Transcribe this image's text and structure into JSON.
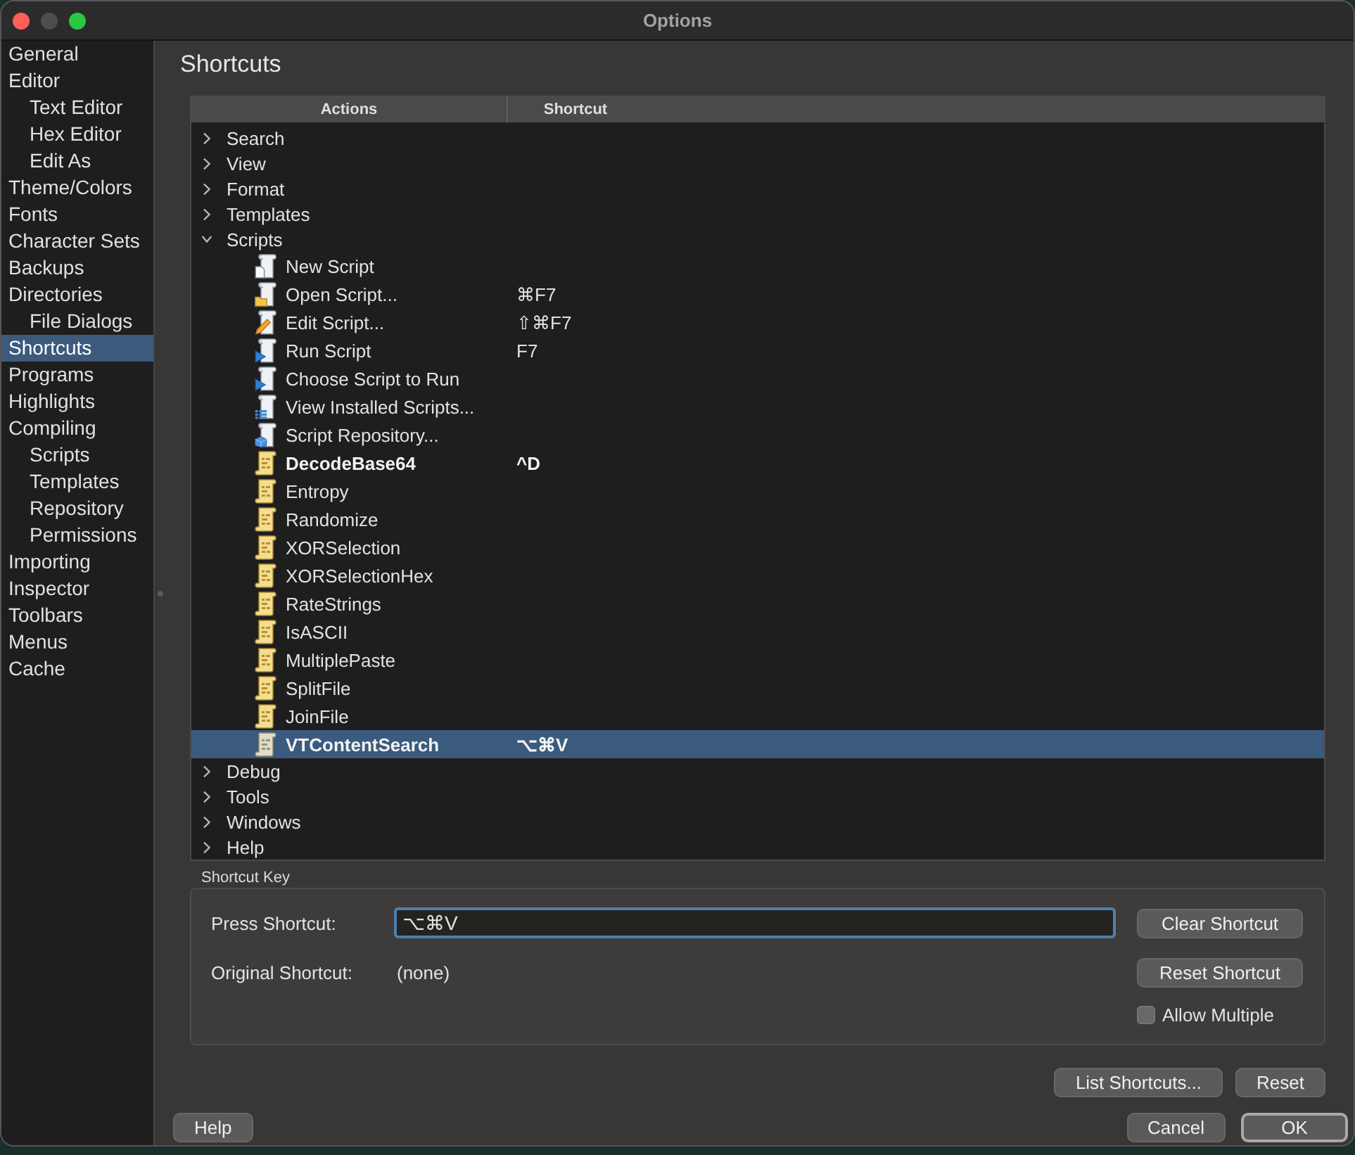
{
  "window": {
    "title": "Options",
    "buttons": [
      {
        "kind": "close",
        "disabled": false
      },
      {
        "kind": "minimize",
        "disabled": true
      },
      {
        "kind": "zoom",
        "disabled": false
      }
    ]
  },
  "sidebar": {
    "items": [
      {
        "label": "General",
        "selected": false
      },
      {
        "label": "Editor",
        "selected": false,
        "children": [
          {
            "label": "Text Editor",
            "selected": false
          },
          {
            "label": "Hex Editor",
            "selected": false
          },
          {
            "label": "Edit As",
            "selected": false
          }
        ]
      },
      {
        "label": "Theme/Colors",
        "selected": false
      },
      {
        "label": "Fonts",
        "selected": false
      },
      {
        "label": "Character Sets",
        "selected": false
      },
      {
        "label": "Backups",
        "selected": false
      },
      {
        "label": "Directories",
        "selected": false,
        "children": [
          {
            "label": "File Dialogs",
            "selected": false
          }
        ]
      },
      {
        "label": "Shortcuts",
        "selected": true
      },
      {
        "label": "Programs",
        "selected": false
      },
      {
        "label": "Highlights",
        "selected": false
      },
      {
        "label": "Compiling",
        "selected": false,
        "children": [
          {
            "label": "Scripts",
            "selected": false
          },
          {
            "label": "Templates",
            "selected": false
          },
          {
            "label": "Repository",
            "selected": false
          },
          {
            "label": "Permissions",
            "selected": false
          }
        ]
      },
      {
        "label": "Importing",
        "selected": false
      },
      {
        "label": "Inspector",
        "selected": false
      },
      {
        "label": "Toolbars",
        "selected": false
      },
      {
        "label": "Menus",
        "selected": false
      },
      {
        "label": "Cache",
        "selected": false
      }
    ]
  },
  "page": {
    "title": "Shortcuts"
  },
  "actions_tree": {
    "columns": [
      "Actions",
      "Shortcut"
    ],
    "rows": [
      {
        "label": "Search",
        "expanded": false,
        "selected": false
      },
      {
        "label": "View",
        "expanded": false,
        "selected": false
      },
      {
        "label": "Format",
        "expanded": false,
        "selected": false
      },
      {
        "label": "Templates",
        "expanded": false,
        "selected": false
      },
      {
        "label": "Scripts",
        "expanded": true,
        "selected": false,
        "children": [
          {
            "label": "New Script",
            "kind": "new",
            "selected": false,
            "modified": false
          },
          {
            "label": "Open Script...",
            "kind": "open",
            "shortcut": "⌘F7",
            "selected": false,
            "modified": false
          },
          {
            "label": "Edit Script...",
            "kind": "edit",
            "shortcut": "⇧⌘F7",
            "selected": false,
            "modified": false
          },
          {
            "label": "Run Script",
            "kind": "run",
            "shortcut": "F7",
            "selected": false,
            "modified": false
          },
          {
            "label": "Choose Script to Run",
            "kind": "run",
            "selected": false,
            "modified": false
          },
          {
            "label": "View Installed Scripts...",
            "kind": "list",
            "selected": false,
            "modified": false
          },
          {
            "label": "Script Repository...",
            "kind": "repository",
            "selected": false,
            "modified": false
          },
          {
            "label": "DecodeBase64",
            "kind": "script",
            "shortcut": "^D",
            "selected": false,
            "modified": true
          },
          {
            "label": "Entropy",
            "kind": "script",
            "selected": false,
            "modified": false
          },
          {
            "label": "Randomize",
            "kind": "script",
            "selected": false,
            "modified": false
          },
          {
            "label": "XORSelection",
            "kind": "script",
            "selected": false,
            "modified": false
          },
          {
            "label": "XORSelectionHex",
            "kind": "script",
            "selected": false,
            "modified": false
          },
          {
            "label": "RateStrings",
            "kind": "script",
            "selected": false,
            "modified": false
          },
          {
            "label": "IsASCII",
            "kind": "script",
            "selected": false,
            "modified": false
          },
          {
            "label": "MultiplePaste",
            "kind": "script",
            "selected": false,
            "modified": false
          },
          {
            "label": "SplitFile",
            "kind": "script",
            "selected": false,
            "modified": false
          },
          {
            "label": "JoinFile",
            "kind": "script",
            "selected": false,
            "modified": false
          },
          {
            "label": "VTContentSearch",
            "kind": "script",
            "shortcut": "⌥⌘V",
            "selected": true,
            "modified": true
          }
        ]
      },
      {
        "label": "Debug",
        "expanded": false,
        "selected": false
      },
      {
        "label": "Tools",
        "expanded": false,
        "selected": false
      },
      {
        "label": "Windows",
        "expanded": false,
        "selected": false
      },
      {
        "label": "Help",
        "expanded": false,
        "selected": false
      }
    ]
  },
  "shortcut_key": {
    "title": "Shortcut Key",
    "press": {
      "label": "Press Shortcut:",
      "value": "⌥⌘V"
    },
    "original": {
      "label": "Original Shortcut:",
      "value": "(none)"
    },
    "buttons": [
      "Clear Shortcut",
      "Reset Shortcut"
    ],
    "allow_multiple": {
      "label": "Allow Multiple",
      "checked": false
    }
  },
  "list_buttons": [
    "List Shortcuts...",
    "Reset"
  ],
  "footer": {
    "help": "Help",
    "buttons": [
      {
        "label": "Cancel",
        "default": false
      },
      {
        "label": "OK",
        "default": true
      }
    ]
  }
}
